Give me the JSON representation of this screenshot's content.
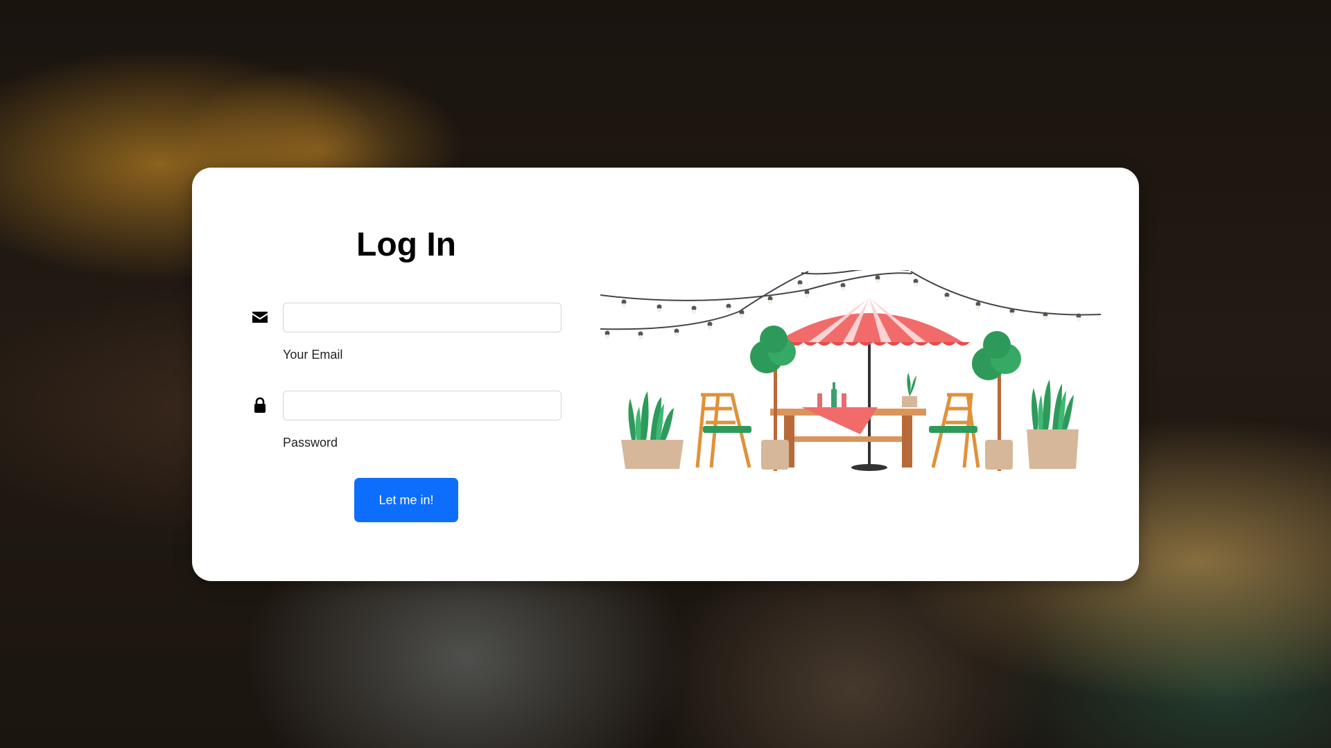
{
  "login": {
    "title": "Log In",
    "email": {
      "label": "Your Email",
      "value": "",
      "icon": "envelope-icon"
    },
    "password": {
      "label": "Password",
      "value": "",
      "icon": "lock-icon"
    },
    "submit_label": "Let me in!"
  },
  "illustration": {
    "name": "outdoor-cafe-illustration"
  },
  "colors": {
    "primary_button": "#0d6efd",
    "card_background": "#ffffff",
    "umbrella": "#f26b6b"
  }
}
